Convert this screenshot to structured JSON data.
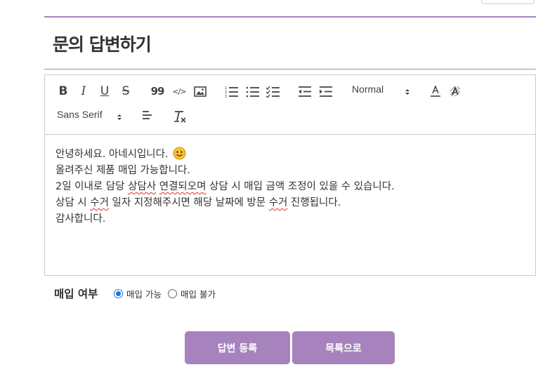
{
  "page": {
    "title": "문의 답변하기"
  },
  "toolbar": {
    "buttons": [
      {
        "name": "bold",
        "glyph": "B"
      },
      {
        "name": "italic",
        "glyph": "I"
      },
      {
        "name": "underline",
        "glyph": "U"
      },
      {
        "name": "strike",
        "glyph": "S"
      },
      {
        "name": "blockquote",
        "glyph": "99"
      },
      {
        "name": "code-block",
        "glyph": "</>"
      }
    ],
    "header_picker": "Normal",
    "font_picker": "Sans Serif"
  },
  "editor": {
    "lines": [
      {
        "parts": [
          {
            "text": "안녕하세요. 아네시입니다. "
          }
        ],
        "emoji": "smiling-face-icon"
      },
      {
        "parts": [
          {
            "text": "올려주신 제품 매입 가능합니다."
          }
        ]
      },
      {
        "parts": [
          {
            "text": "2일 이내로 담당 "
          },
          {
            "text": "상담사",
            "spell": true
          },
          {
            "text": " "
          },
          {
            "text": "연결되오며",
            "spell": true
          },
          {
            "text": " 상담 시 매입 금액 조정이 있을 수 있습니다."
          }
        ]
      },
      {
        "parts": [
          {
            "text": "상담 시 "
          },
          {
            "text": "수거",
            "spell": true
          },
          {
            "text": " 일자 지정해주시면 해당 날짜에 방문 "
          },
          {
            "text": "수거",
            "spell": true
          },
          {
            "text": " 진행됩니다."
          }
        ]
      },
      {
        "parts": [
          {
            "text": "감사합니다."
          }
        ]
      }
    ]
  },
  "purchase": {
    "label": "매입 여부",
    "options": [
      {
        "label": "매입 가능",
        "checked": true
      },
      {
        "label": "매입 불가",
        "checked": false
      }
    ]
  },
  "actions": {
    "submit_label": "답변 등록",
    "list_label": "목록으로"
  },
  "colors": {
    "accent": "#a783be",
    "radio_checked": "#1a73e8",
    "spellcheck": "#e0302f"
  }
}
